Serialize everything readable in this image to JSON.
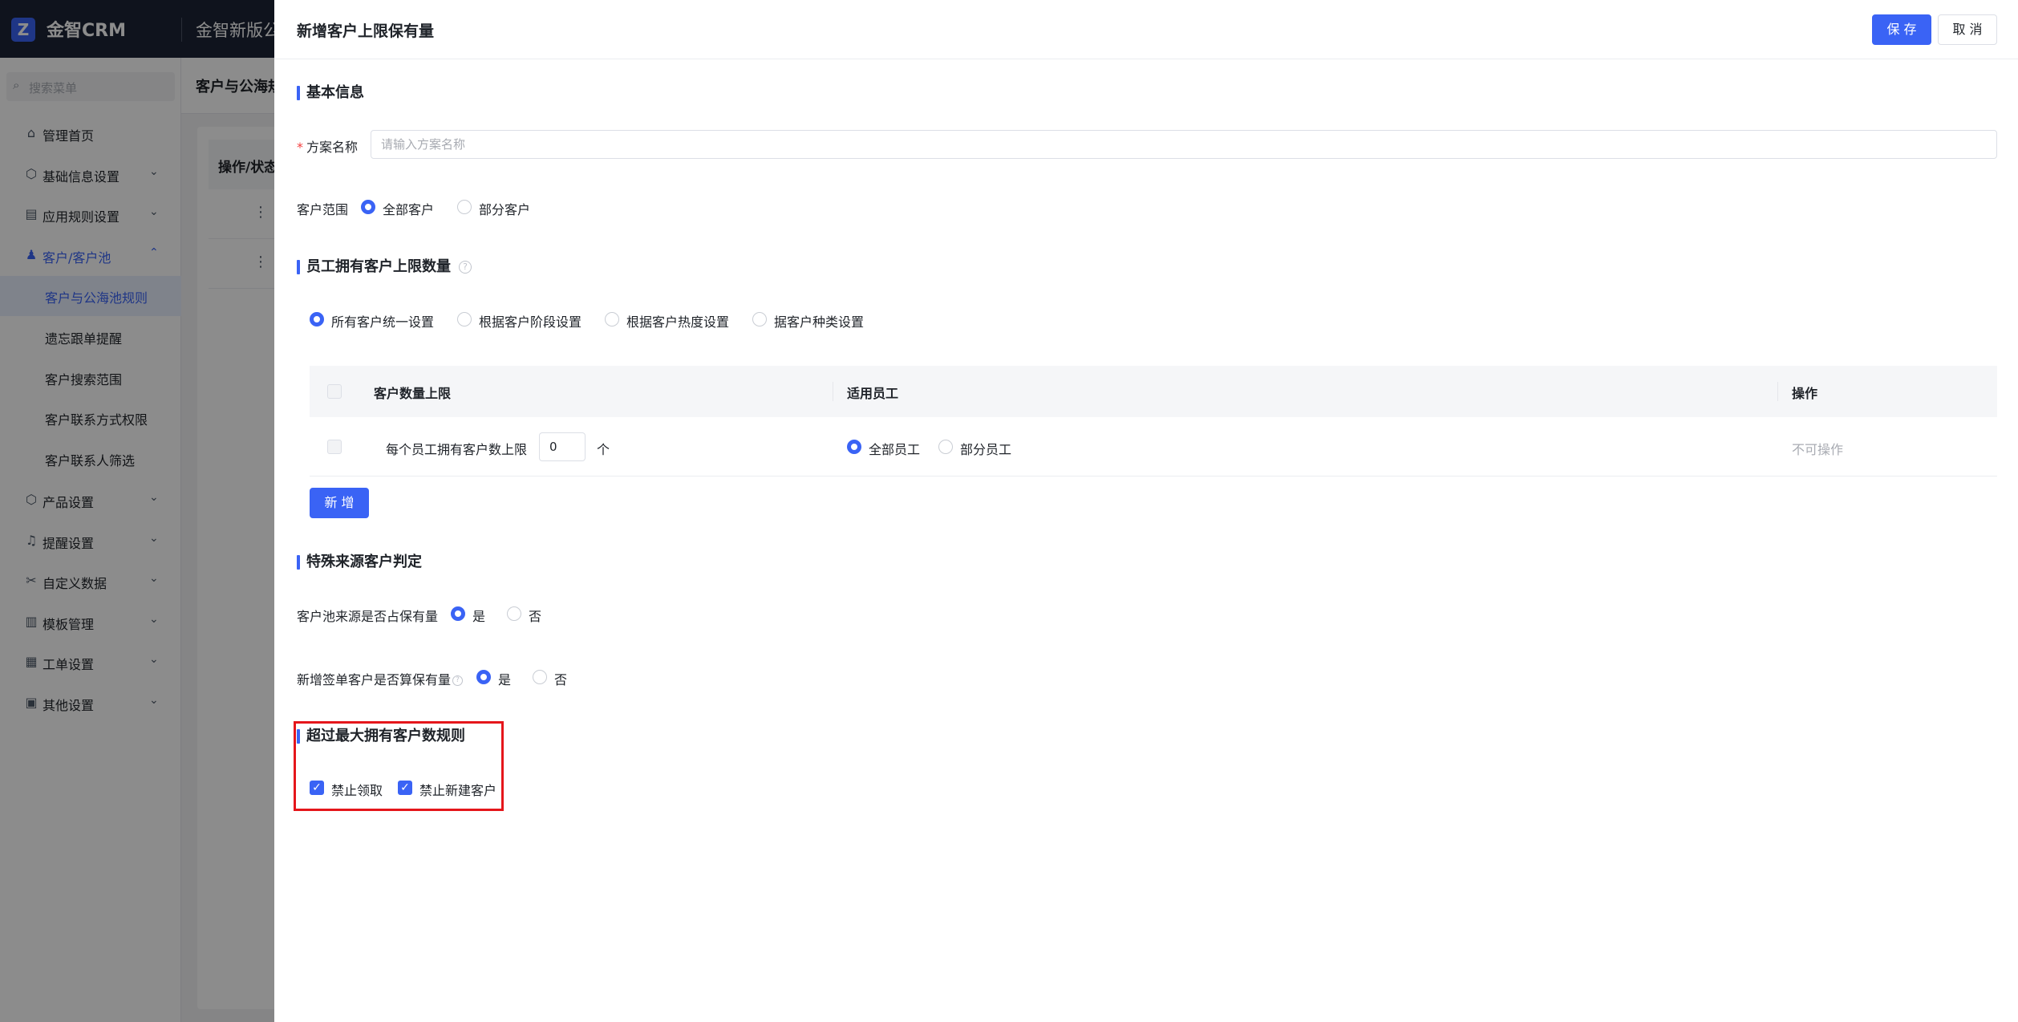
{
  "app": {
    "logo_text": "金智CRM",
    "company": "金智新版公"
  },
  "sidebar": {
    "search_placeholder": "搜索菜单",
    "items": [
      {
        "label": "管理首页",
        "icon": "home-icon"
      },
      {
        "label": "基础信息设置",
        "icon": "cube-icon"
      },
      {
        "label": "应用规则设置",
        "icon": "document-icon"
      },
      {
        "label": "客户/客户池",
        "icon": "users-icon"
      },
      {
        "label": "产品设置",
        "icon": "box-icon"
      },
      {
        "label": "提醒设置",
        "icon": "bell-icon"
      },
      {
        "label": "自定义数据",
        "icon": "tools-icon"
      },
      {
        "label": "模板管理",
        "icon": "template-icon"
      },
      {
        "label": "工单设置",
        "icon": "form-icon"
      },
      {
        "label": "其他设置",
        "icon": "grid-icon"
      }
    ],
    "sub_items": [
      "客户与公海池规则",
      "遗忘跟单提醒",
      "客户搜索范围",
      "客户联系方式权限",
      "客户联系人筛选"
    ]
  },
  "background": {
    "tab_label": "客户与公海规",
    "table_header": "操作/状态"
  },
  "drawer": {
    "title": "新增客户上限保有量",
    "save_label": "保 存",
    "cancel_label": "取 消",
    "basic_section": "基本信息",
    "plan_name_label": "方案名称",
    "plan_name_placeholder": "请输入方案名称",
    "scope_label": "客户范围",
    "scope_options": [
      "全部客户",
      "部分客户"
    ],
    "limit_section": "员工拥有客户上限数量",
    "limit_modes": [
      "所有客户统一设置",
      "根据客户阶段设置",
      "根据客户热度设置",
      "据客户种类设置"
    ],
    "table": {
      "headers": [
        "客户数量上限",
        "适用员工",
        "操作"
      ],
      "row": {
        "limit_label": "每个员工拥有客户数上限",
        "limit_value": "0",
        "unit": "个",
        "employee_options": [
          "全部员工",
          "部分员工"
        ],
        "action": "不可操作"
      }
    },
    "add_label": "新 增",
    "special_section": "特殊来源客户判定",
    "pool_source_label": "客户池来源是否占保有量",
    "new_signed_label": "新增签单客户是否算保有量",
    "yes": "是",
    "no": "否",
    "exceed_section": "超过最大拥有客户数规则",
    "exceed_options": [
      "禁止领取",
      "禁止新建客户"
    ]
  },
  "colors": {
    "accent": "#3a63f5",
    "highlight": "#e5161b",
    "header_bg": "#1c2436"
  }
}
